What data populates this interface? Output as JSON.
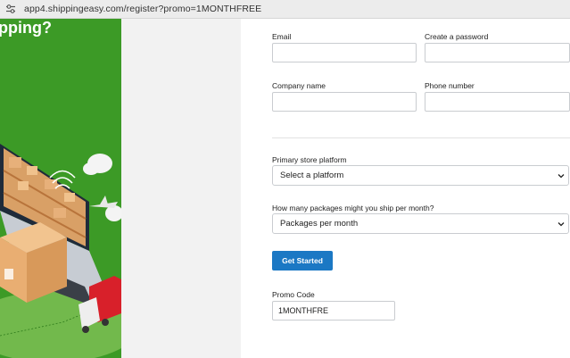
{
  "browser": {
    "url": "app4.shippingeasy.com/register?promo=1MONTHFREE"
  },
  "hero": {
    "title": "pping?"
  },
  "form": {
    "email_label": "Email",
    "password_label": "Create a password",
    "company_label": "Company name",
    "phone_label": "Phone number",
    "platform_label": "Primary store platform",
    "platform_value": "Select a platform",
    "packages_label": "How many packages might you ship per month?",
    "packages_value": "Packages per month",
    "submit_label": "Get Started",
    "promo_label": "Promo Code",
    "promo_value": "1MONTHFRE"
  },
  "colors": {
    "hero_green": "#3c9a26",
    "button_blue": "#1b78c4"
  }
}
